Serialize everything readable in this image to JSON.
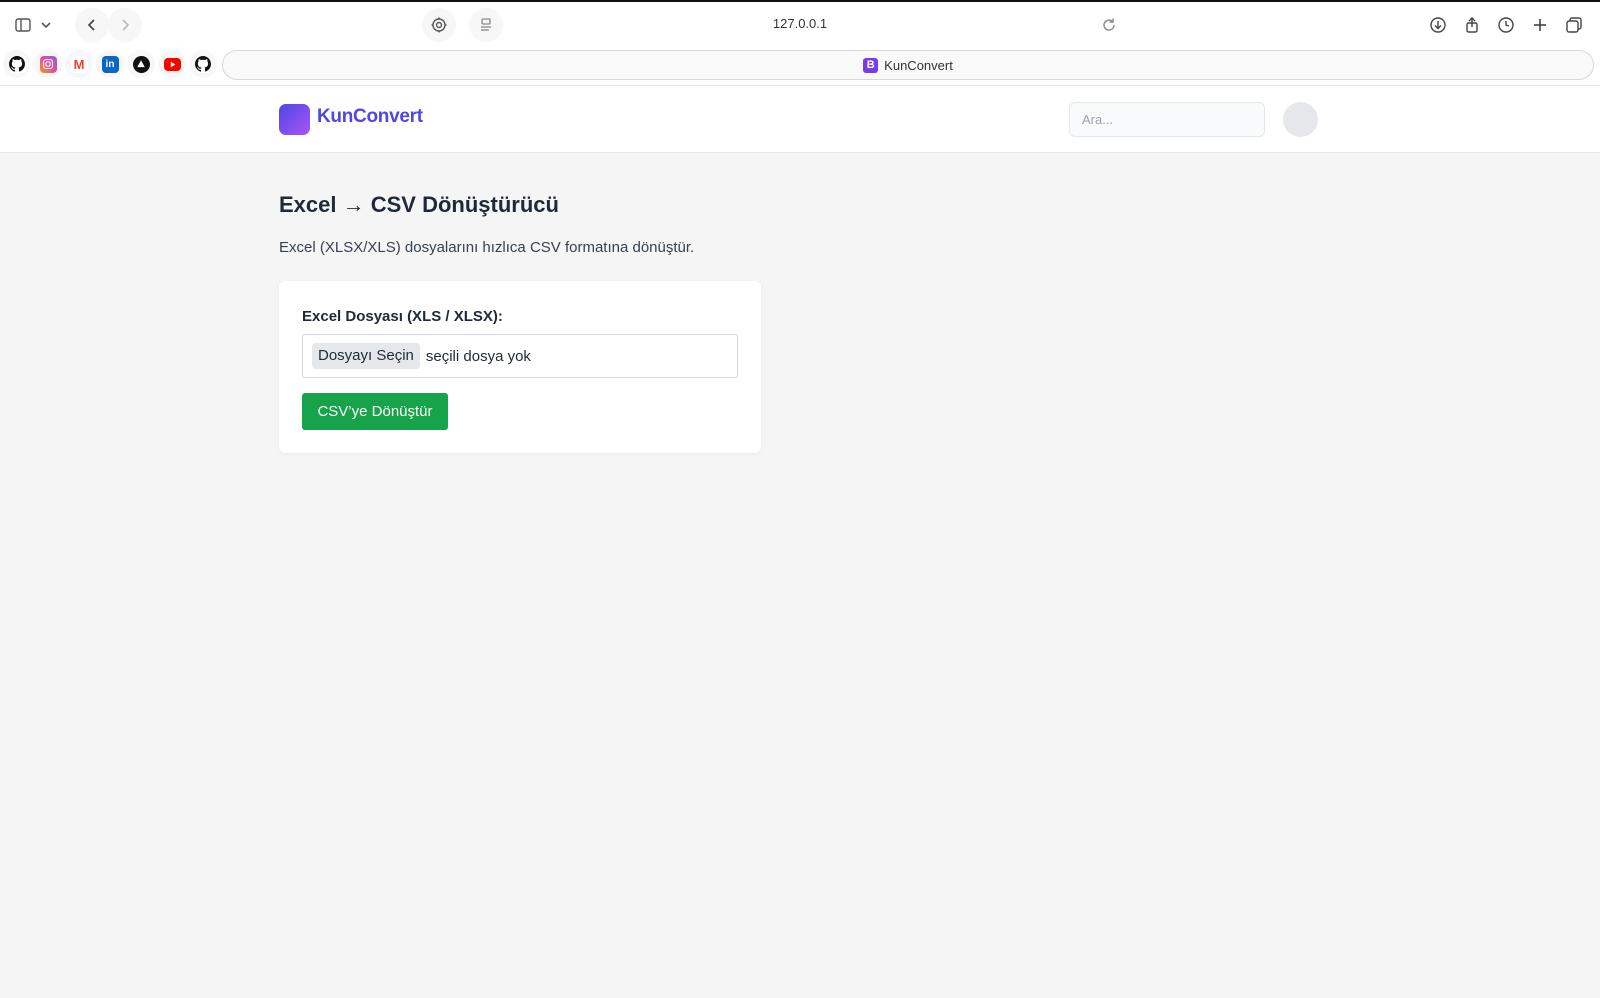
{
  "browser": {
    "url": "127.0.0.1",
    "tab_title": "KunConvert",
    "tab_favicon_letter": "B",
    "bookmarks": [
      {
        "name": "github",
        "icon": "github-icon"
      },
      {
        "name": "instagram",
        "icon": "instagram-icon"
      },
      {
        "name": "gmail",
        "icon": "gmail-icon"
      },
      {
        "name": "linkedin",
        "icon": "linkedin-icon"
      },
      {
        "name": "vercel",
        "icon": "triangle-icon"
      },
      {
        "name": "youtube",
        "icon": "youtube-icon"
      },
      {
        "name": "github",
        "icon": "github-icon"
      }
    ]
  },
  "header": {
    "logo_text": "KunConvert",
    "search_placeholder": "Ara..."
  },
  "main": {
    "title": "Excel → CSV Dönüştürücü",
    "description": "Excel (XLSX/XLS) dosyalarını hızlıca CSV formatına dönüştür.",
    "form": {
      "field_label": "Excel Dosyası (XLS / XLSX):",
      "file_button_label": "Dosyayı Seçin",
      "file_status": "seçili dosya yok",
      "submit_label": "CSV’ye Dönüştür"
    }
  },
  "colors": {
    "accent": "#4f46e5",
    "button_green": "#16a34a",
    "background": "#f5f5f5"
  }
}
